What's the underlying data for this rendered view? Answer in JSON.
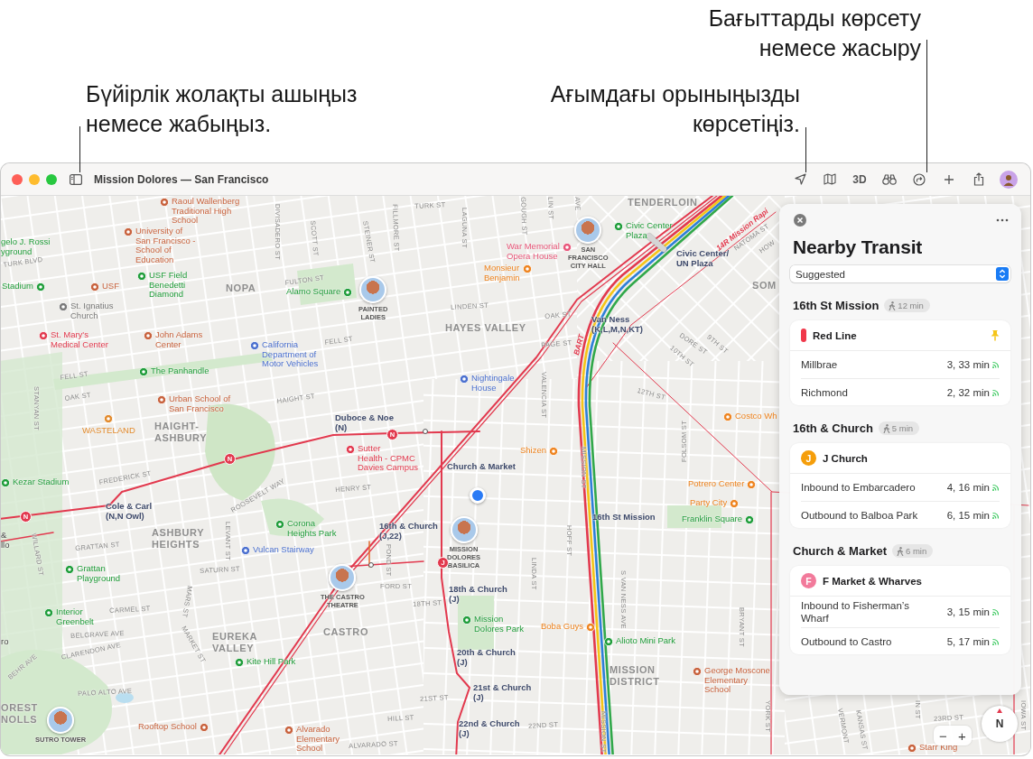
{
  "callouts": [
    {
      "text": "Бүйірлік жолақты ашыңыз\nнемесе жабыңыз."
    },
    {
      "text": "Ағымдағы орыныңызды\nкөрсетіңіз."
    },
    {
      "text": "Бағыттарды көрсету\nнемесе жасыру"
    }
  ],
  "window": {
    "title": "Mission Dolores — San Francisco",
    "view_button": "3D"
  },
  "map": {
    "labels": [
      {
        "text": "Raoul Wallenberg\nTraditional High\nSchool",
        "kind": "school"
      },
      {
        "text": "gelo J. Rossi\nyground",
        "kind": "park_text"
      },
      {
        "text": "University of\nSan Francisco -\nSchool of\nEducation",
        "kind": "school"
      },
      {
        "text": "TURK BLVD",
        "kind": "street"
      },
      {
        "text": "Stadium",
        "kind": "park"
      },
      {
        "text": "USF",
        "kind": "school"
      },
      {
        "text": "USF Field\nBenedetti\nDiamond",
        "kind": "park"
      },
      {
        "text": "St. Ignatius\nChurch",
        "kind": "church"
      },
      {
        "text": "NOPA",
        "kind": "neighborhood"
      },
      {
        "text": "FULTON ST",
        "kind": "street"
      },
      {
        "text": "Alamo Square",
        "kind": "park"
      },
      {
        "text": "PAINTED\nLADIES",
        "kind": "landmark"
      },
      {
        "text": "DIVISADERO ST",
        "kind": "street"
      },
      {
        "text": "SCOTT ST",
        "kind": "street"
      },
      {
        "text": "STEINER ST",
        "kind": "street"
      },
      {
        "text": "FILLMORE ST",
        "kind": "street"
      },
      {
        "text": "St. Mary's\nMedical Center",
        "kind": "hospital"
      },
      {
        "text": "John Adams\nCenter",
        "kind": "school"
      },
      {
        "text": "FELL ST",
        "kind": "street"
      },
      {
        "text": "California\nDepartment of\nMotor Vehicles",
        "kind": "place"
      },
      {
        "text": "The Panhandle",
        "kind": "park"
      },
      {
        "text": "FELL ST",
        "kind": "street"
      },
      {
        "text": "OAK ST",
        "kind": "street"
      },
      {
        "text": "STANYAN ST",
        "kind": "street"
      },
      {
        "text": "HAIGHT ST",
        "kind": "street"
      },
      {
        "text": "Urban School of\nSan Francisco",
        "kind": "school"
      },
      {
        "text": "WASTELAND",
        "kind": "shop"
      },
      {
        "text": "HAIGHT-\nASHBURY",
        "kind": "neighborhood"
      },
      {
        "text": "Duboce & Noe\n(N)",
        "kind": "station"
      },
      {
        "text": "Sutter\nHealth - CPMC\nDavies Campus",
        "kind": "hospital"
      },
      {
        "text": "Kezar Stadium",
        "kind": "park"
      },
      {
        "text": "FREDERICK ST",
        "kind": "street"
      },
      {
        "text": "HENRY ST",
        "kind": "street"
      },
      {
        "text": "Cole & Carl\n(N,N Owl)",
        "kind": "station"
      },
      {
        "text": "ROOSEVELT WAY",
        "kind": "street"
      },
      {
        "text": "ASHBURY\nHEIGHTS",
        "kind": "neighborhood"
      },
      {
        "text": "Corona\nHeights Park",
        "kind": "park"
      },
      {
        "text": "LEVANT ST",
        "kind": "street"
      },
      {
        "text": "&\nllo",
        "kind": "other"
      },
      {
        "text": "WILLARD ST",
        "kind": "street"
      },
      {
        "text": "GRATTAN ST",
        "kind": "street"
      },
      {
        "text": "Vulcan Stairway",
        "kind": "place"
      },
      {
        "text": "Grattan\nPlayground",
        "kind": "park"
      },
      {
        "text": "SATURN ST",
        "kind": "street"
      },
      {
        "text": "POND ST",
        "kind": "street"
      },
      {
        "text": "FORD ST",
        "kind": "street"
      },
      {
        "text": "THE CASTRO\nTHEATRE",
        "kind": "landmark"
      },
      {
        "text": "Interior\nGreenbelt",
        "kind": "park"
      },
      {
        "text": "CARMEL ST",
        "kind": "street"
      },
      {
        "text": "MARS ST",
        "kind": "street"
      },
      {
        "text": "MARKET ST",
        "kind": "street"
      },
      {
        "text": "BELGRAVE AVE",
        "kind": "street"
      },
      {
        "text": "CLARENDON AVE",
        "kind": "street"
      },
      {
        "text": "BEHR AVE",
        "kind": "street"
      },
      {
        "text": "ro",
        "kind": "other"
      },
      {
        "text": "EUREKA\nVALLEY",
        "kind": "neighborhood"
      },
      {
        "text": "CASTRO",
        "kind": "neighborhood"
      },
      {
        "text": "Kite Hill Park",
        "kind": "park"
      },
      {
        "text": "PALO ALTO AVE",
        "kind": "street"
      },
      {
        "text": "OREST\nNOLLS",
        "kind": "neighborhood"
      },
      {
        "text": "SUTRO TOWER",
        "kind": "landmark"
      },
      {
        "text": "Rooftop School",
        "kind": "school"
      },
      {
        "text": "Alvarado\nElementary\nSchool",
        "kind": "school"
      },
      {
        "text": "ALVARADO ST",
        "kind": "street"
      },
      {
        "text": "HILL ST",
        "kind": "street"
      },
      {
        "text": "TURK ST",
        "kind": "street"
      },
      {
        "text": "LAGUNA ST",
        "kind": "street"
      },
      {
        "text": "GOUGH ST",
        "kind": "street"
      },
      {
        "text": "LIN ST",
        "kind": "street"
      },
      {
        "text": "AVE",
        "kind": "street"
      },
      {
        "text": "TENDERLOIN",
        "kind": "neighborhood"
      },
      {
        "text": "Civic Center\nPlaza",
        "kind": "park"
      },
      {
        "text": "SAN\nFRANCISCO\nCITY HALL",
        "kind": "landmark"
      },
      {
        "text": "War Memorial\nOpera House",
        "kind": "venue"
      },
      {
        "text": "Monsieur\nBenjamin",
        "kind": "food"
      },
      {
        "text": "Civic Center/\nUN Plaza",
        "kind": "station"
      },
      {
        "text": "14R Mission Rapi",
        "kind": "route"
      },
      {
        "text": "NATOMA ST",
        "kind": "street"
      },
      {
        "text": "HOW",
        "kind": "street"
      },
      {
        "text": "SOM",
        "kind": "neighborhood"
      },
      {
        "text": "LINDEN ST",
        "kind": "street"
      },
      {
        "text": "HAYES VALLEY",
        "kind": "neighborhood"
      },
      {
        "text": "OAK ST",
        "kind": "street"
      },
      {
        "text": "PAGE ST",
        "kind": "street"
      },
      {
        "text": "Van Ness\n(K,L,M,N,KT)",
        "kind": "station"
      },
      {
        "text": "BART",
        "kind": "route"
      },
      {
        "text": "DORE ST",
        "kind": "street"
      },
      {
        "text": "10TH ST",
        "kind": "street"
      },
      {
        "text": "9TH ST",
        "kind": "street"
      },
      {
        "text": "Nightingale\nHouse",
        "kind": "place"
      },
      {
        "text": "VALENCIA ST",
        "kind": "street"
      },
      {
        "text": "12TH ST",
        "kind": "street"
      },
      {
        "text": "Costco Wh",
        "kind": "food"
      },
      {
        "text": "Shizen",
        "kind": "food"
      },
      {
        "text": "FOLSOM ST",
        "kind": "street"
      },
      {
        "text": "Church & Market",
        "kind": "station"
      },
      {
        "text": "MISSION ST",
        "kind": "street"
      },
      {
        "text": "Potrero Center",
        "kind": "food"
      },
      {
        "text": "Party City",
        "kind": "food"
      },
      {
        "text": "16th St Mission",
        "kind": "station"
      },
      {
        "text": "Franklin Square",
        "kind": "park"
      },
      {
        "text": "16th & Church\n(J,22)",
        "kind": "station"
      },
      {
        "text": "HOFF ST",
        "kind": "street"
      },
      {
        "text": "MISSION\nDOLORES\nBASILICA",
        "kind": "landmark"
      },
      {
        "text": "18TH ST",
        "kind": "street"
      },
      {
        "text": "18th & Church\n(J)",
        "kind": "station"
      },
      {
        "text": "LINDA ST",
        "kind": "street"
      },
      {
        "text": "S VAN NESS AVE",
        "kind": "street"
      },
      {
        "text": "BRYANT ST",
        "kind": "street"
      },
      {
        "text": "Mission\nDolores Park",
        "kind": "park"
      },
      {
        "text": "Boba Guys",
        "kind": "food"
      },
      {
        "text": "Alioto Mini Park",
        "kind": "park"
      },
      {
        "text": "20th & Church\n(J)",
        "kind": "station"
      },
      {
        "text": "MISSION\nDISTRICT",
        "kind": "neighborhood"
      },
      {
        "text": "George Moscone\nElementary\nSchool",
        "kind": "school"
      },
      {
        "text": "21ST ST",
        "kind": "street"
      },
      {
        "text": "21st & Church\n(J)",
        "kind": "station"
      },
      {
        "text": "22ND ST",
        "kind": "street"
      },
      {
        "text": "22nd & Church\n(J)",
        "kind": "station"
      },
      {
        "text": "YORK ST",
        "kind": "street"
      },
      {
        "text": "MISSION ST",
        "kind": "street"
      },
      {
        "text": "VERMONT",
        "kind": "street"
      },
      {
        "text": "KANSAS ST",
        "kind": "street"
      },
      {
        "text": "IN ST",
        "kind": "street"
      },
      {
        "text": "23RD ST",
        "kind": "street"
      },
      {
        "text": "IOWA ST",
        "kind": "street"
      },
      {
        "text": "Starr King",
        "kind": "school"
      },
      {
        "text": "N",
        "kind": "stop"
      },
      {
        "text": "N",
        "kind": "stop"
      },
      {
        "text": "N",
        "kind": "stop"
      },
      {
        "text": "J",
        "kind": "stop"
      }
    ],
    "zoom": {
      "out": "−",
      "in": "+"
    },
    "compass": "N"
  },
  "panel": {
    "title": "Nearby Transit",
    "sort": {
      "value": "Suggested"
    },
    "stations": [
      {
        "name": "16th St Mission",
        "walk": "12 min",
        "lines": [
          {
            "name": "Red Line",
            "kind": "bar",
            "color": "#f0384a",
            "pinned": true,
            "departures": [
              {
                "destination": "Millbrae",
                "times": "3, 33 min"
              },
              {
                "destination": "Richmond",
                "times": "2, 32 min"
              }
            ]
          }
        ]
      },
      {
        "name": "16th & Church",
        "walk": "5 min",
        "lines": [
          {
            "name": "J Church",
            "kind": "letter",
            "letter": "J",
            "color": "#f59e0b",
            "pinned": false,
            "departures": [
              {
                "destination": "Inbound to Embarcadero",
                "times": "4, 16 min"
              },
              {
                "destination": "Outbound to Balboa Park",
                "times": "6, 15 min"
              }
            ]
          }
        ]
      },
      {
        "name": "Church & Market",
        "walk": "6 min",
        "lines": [
          {
            "name": "F Market & Wharves",
            "kind": "letter",
            "letter": "F",
            "color": "#f27a9b",
            "pinned": false,
            "departures": [
              {
                "destination": "Inbound to Fisherman’s Wharf",
                "times": "3, 15 min"
              },
              {
                "destination": "Outbound to Castro",
                "times": "5, 17 min"
              }
            ]
          }
        ]
      }
    ]
  }
}
